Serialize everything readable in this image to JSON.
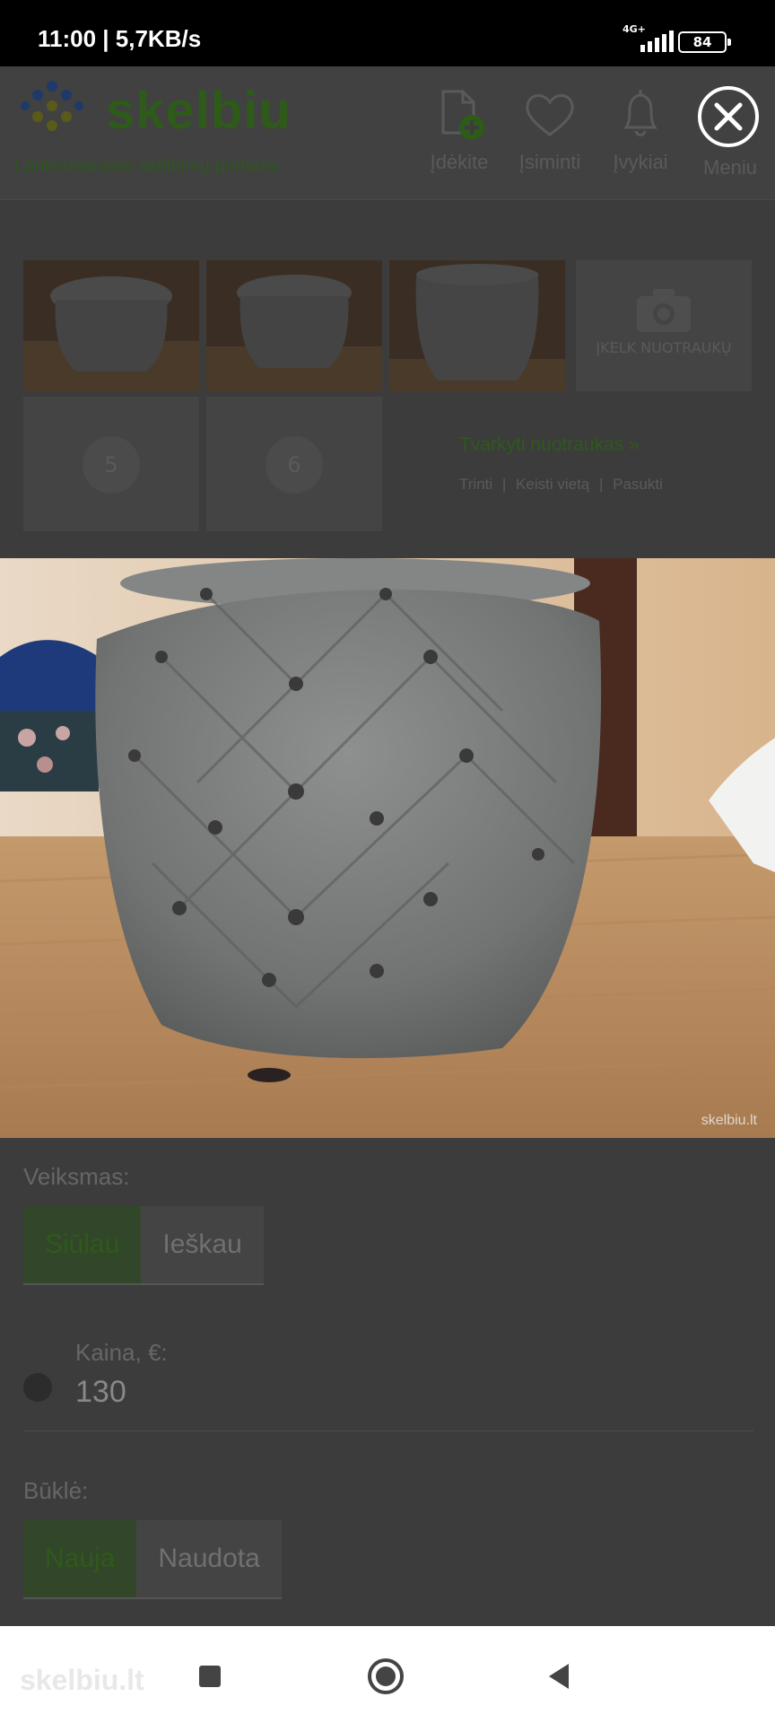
{
  "status": {
    "time_speed": "11:00 | 5,7KB/s",
    "network_type": "4G+",
    "battery": "84"
  },
  "header": {
    "logo": "skelbiu",
    "tagline": "Lankomiausias skelbimų portalas",
    "nav": [
      {
        "label": "Įdėkite",
        "icon": "add-document-icon"
      },
      {
        "label": "Įsiminti",
        "icon": "heart-icon"
      },
      {
        "label": "Įvykiai",
        "icon": "bell-icon"
      },
      {
        "label": "Meniu",
        "icon": "close-icon"
      }
    ]
  },
  "photos": {
    "upload_label": "ĮKELK NUOTRAUKŲ",
    "slot_numbers": [
      "5",
      "6"
    ],
    "manage_link": "Tvarkyti nuotraukas »",
    "actions": [
      "Trinti",
      "|",
      "Keisti vietą",
      "|",
      "Pasukti"
    ]
  },
  "main_photo": {
    "watermark": "skelbiu.lt"
  },
  "form": {
    "action_label": "Veiksmas:",
    "action_options": [
      "Siūlau",
      "Ieškau"
    ],
    "action_selected": "Siūlau",
    "price_label": "Kaina, €:",
    "price_value": "130",
    "condition_label": "Būklė:",
    "condition_options": [
      "Nauja",
      "Naudota"
    ],
    "condition_selected": "Nauja"
  },
  "navbar": {
    "watermark": "skelbiu.lt"
  },
  "colors": {
    "brand_green": "#2e5a1a",
    "overlay_bg": "#3c3c3c"
  }
}
